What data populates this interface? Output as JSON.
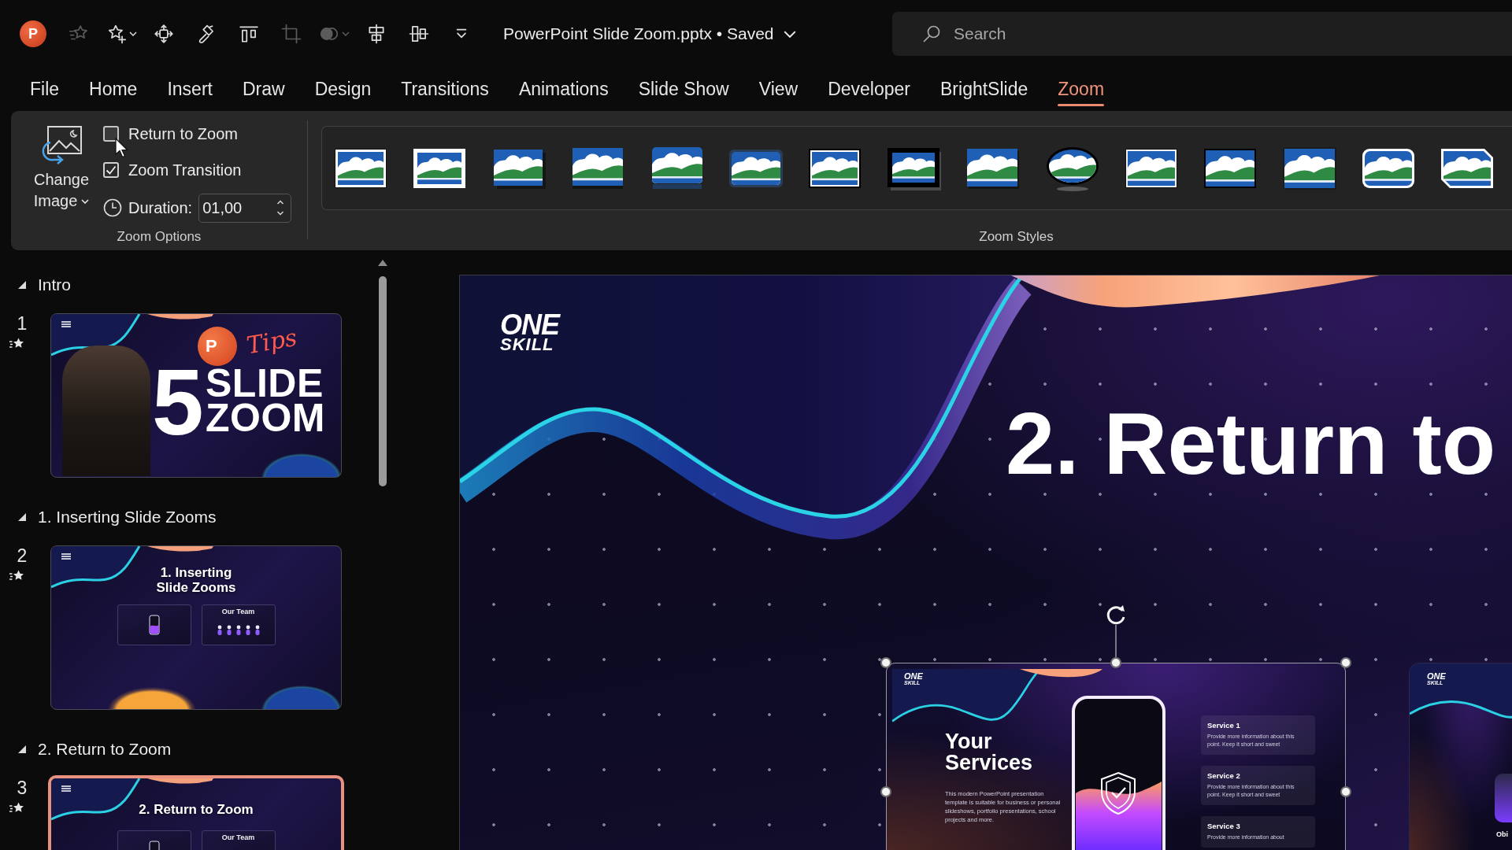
{
  "title_bar": {
    "app_logo": "P",
    "quick_access": [
      {
        "kind": "favorite",
        "disabled": true,
        "dropdown": false
      },
      {
        "kind": "star",
        "disabled": false,
        "dropdown": true
      },
      {
        "kind": "move",
        "disabled": false,
        "dropdown": false
      },
      {
        "kind": "painter",
        "disabled": false,
        "dropdown": false
      },
      {
        "kind": "align",
        "disabled": false,
        "dropdown": false
      },
      {
        "kind": "crop",
        "disabled": true,
        "dropdown": false
      },
      {
        "kind": "fill",
        "disabled": true,
        "dropdown": true
      },
      {
        "kind": "center",
        "disabled": false,
        "dropdown": false
      },
      {
        "kind": "middle",
        "disabled": false,
        "dropdown": false
      },
      {
        "kind": "customize",
        "disabled": false,
        "dropdown": false
      }
    ],
    "document_title": "PowerPoint Slide Zoom.pptx • Saved",
    "search": {
      "placeholder": "Search"
    }
  },
  "menu_tabs": [
    {
      "label": "File",
      "selected": false
    },
    {
      "label": "Home",
      "selected": false
    },
    {
      "label": "Insert",
      "selected": false
    },
    {
      "label": "Draw",
      "selected": false
    },
    {
      "label": "Design",
      "selected": false
    },
    {
      "label": "Transitions",
      "selected": false
    },
    {
      "label": "Animations",
      "selected": false
    },
    {
      "label": "Slide Show",
      "selected": false
    },
    {
      "label": "View",
      "selected": false
    },
    {
      "label": "Developer",
      "selected": false
    },
    {
      "label": "BrightSlide",
      "selected": false
    },
    {
      "label": "Zoom",
      "selected": true
    }
  ],
  "ribbon": {
    "change_image": {
      "lines": [
        "Change",
        "Image"
      ]
    },
    "options": [
      {
        "label": "Return to Zoom",
        "checked": false
      },
      {
        "label": "Zoom Transition",
        "checked": true
      }
    ],
    "duration": {
      "label": "Duration:",
      "value": "01,00"
    },
    "options_group_label": "Zoom Options",
    "zoom_styles": [
      {
        "kind": "frame"
      },
      {
        "kind": "matte"
      },
      {
        "kind": "shadow"
      },
      {
        "kind": "soft"
      },
      {
        "kind": "reflection"
      },
      {
        "kind": "feathered"
      },
      {
        "kind": "double"
      },
      {
        "kind": "black"
      },
      {
        "kind": "plain"
      },
      {
        "kind": "oval"
      },
      {
        "kind": "bevel"
      },
      {
        "kind": "border"
      },
      {
        "kind": "glow"
      },
      {
        "kind": "rounded"
      },
      {
        "kind": "snipped"
      }
    ],
    "styles_group_label": "Zoom Styles"
  },
  "slides_pane": {
    "sections": [
      {
        "title": "Intro",
        "expanded": true,
        "slides": [
          {
            "number": "1",
            "animated": true,
            "selected": false,
            "kind": "cover",
            "logo": "P",
            "tag": "Tips",
            "big_number": "5",
            "heading_lines": [
              "SLIDE",
              "ZOOM"
            ]
          }
        ]
      },
      {
        "title": "1. Inserting Slide Zooms",
        "expanded": true,
        "slides": [
          {
            "number": "2",
            "animated": true,
            "selected": false,
            "kind": "section",
            "heading_lines": [
              "1. Inserting",
              "Slide Zooms"
            ],
            "previews": [
              {
                "kind": "services"
              },
              {
                "kind": "team",
                "label": "Our Team"
              }
            ]
          }
        ]
      },
      {
        "title": "2. Return to Zoom",
        "expanded": true,
        "slides": [
          {
            "number": "3",
            "animated": true,
            "selected": true,
            "kind": "section",
            "heading_lines": [
              "2. Return to Zoom"
            ],
            "previews": [
              {
                "kind": "services"
              },
              {
                "kind": "team",
                "label": "Our Team"
              }
            ]
          }
        ]
      }
    ]
  },
  "slide": {
    "logo": [
      "ONE",
      "SKILL"
    ],
    "title": "2. Return to",
    "zoom_objects": [
      {
        "kind": "services",
        "selected": true,
        "logo": [
          "ONE",
          "SKILL"
        ],
        "heading": "Your Services",
        "description": "This modern PowerPoint presentation template is suitable for business or personal slideshows, portfolio presentations, school projects and more.",
        "services": [
          {
            "title": "Service 1",
            "text": "Provide more information about this point. Keep it short and sweet"
          },
          {
            "title": "Service 2",
            "text": "Provide more information about this point. Keep it short and sweet"
          },
          {
            "title": "Service 3",
            "text": "Provide more information about"
          }
        ]
      },
      {
        "kind": "profile",
        "selected": false,
        "logo": [
          "ONE",
          "SKILL"
        ],
        "caption": "Obi"
      }
    ]
  }
}
